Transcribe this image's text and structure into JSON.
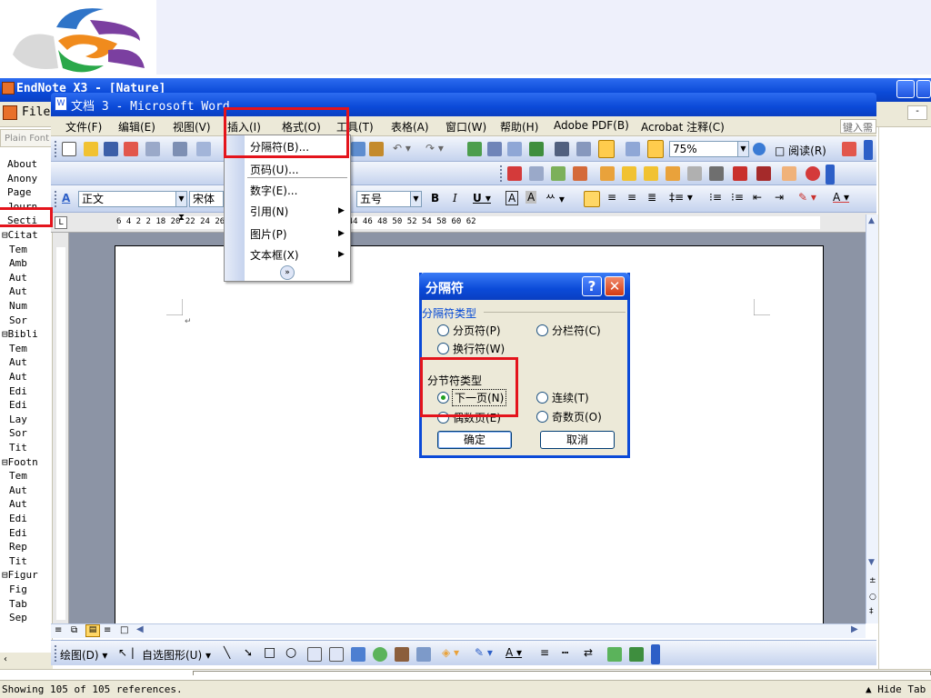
{
  "endnote": {
    "title": "EndNote X3 - [Nature]",
    "menu_file": "File",
    "side_header": "Plain Font",
    "tree": [
      "About",
      "Anony",
      "Page",
      "Journ",
      "Secti",
      "⊟Citat",
      "Tem",
      "Amb",
      "Aut",
      "Aut",
      "Num",
      "Sor",
      "⊟Bibli",
      "Tem",
      "Aut",
      "Aut",
      "Edi",
      "Edi",
      "Lay",
      "Sor",
      "Tit",
      "⊟Footn",
      "Tem",
      "Aut",
      "Aut",
      "Edi",
      "Edi",
      "Rep",
      "Tit",
      "⊟Figur",
      "Fig",
      "Tab",
      "Sep"
    ],
    "status_text": "Showing 105 of 105 references.",
    "hide_tab": "▲ Hide Tab"
  },
  "word": {
    "title": "文档 3 - Microsoft Word",
    "menu": [
      "文件(F)",
      "编辑(E)",
      "视图(V)",
      "插入(I)",
      "格式(O)",
      "工具(T)",
      "表格(A)",
      "窗口(W)",
      "帮助(H)",
      "Adobe PDF(B)",
      "Acrobat 注释(C)"
    ],
    "search_placeholder": "键入需",
    "zoom": "75%",
    "read_label": "阅读(R)",
    "style_combo": "正文",
    "font_combo": "宋体",
    "size_combo": "五号",
    "ruler_numbers": "6  4  2       2                                   18  20  22  24  26  28  30  32  34  36  38  40  42  44  46  48  50  52  54     58  60  62",
    "draw_label": "绘图(D)",
    "autoshape_label": "自选图形(U)"
  },
  "insert_menu": {
    "items": [
      "分隔符(B)...",
      "页码(U)...",
      "数字(E)...",
      "引用(N)",
      "图片(P)",
      "文本框(X)"
    ]
  },
  "dialog": {
    "title": "分隔符",
    "group1": "分隔符类型",
    "opt_page": "分页符(P)",
    "opt_column": "分栏符(C)",
    "opt_wrap": "换行符(W)",
    "group2": "分节符类型",
    "opt_next": "下一页(N)",
    "opt_continuous": "连续(T)",
    "opt_even": "偶数页(E)",
    "opt_odd": "奇数页(O)",
    "ok": "确定",
    "cancel": "取消"
  },
  "colors": {
    "highlight": "#e4141c",
    "titlebar": "#0b4ad8",
    "menubar": "#ece9d8"
  }
}
